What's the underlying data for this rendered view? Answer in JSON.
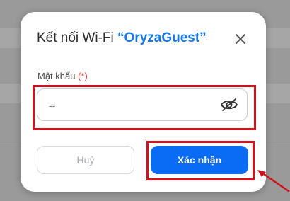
{
  "dialog": {
    "title_prefix": "Kết nối Wi-Fi ",
    "ssid": "“OryzaGuest”",
    "close_icon": "close-icon",
    "password": {
      "label": "Mật khẩu",
      "required_mark": "(*)",
      "placeholder": "--",
      "value": "",
      "toggle_icon": "eye-off-icon"
    },
    "buttons": {
      "cancel_label": "Huỷ",
      "confirm_label": "Xác nhận"
    }
  },
  "colors": {
    "accent": "#1677e8",
    "confirm_bg": "#0a6cf5",
    "annotation": "#d3111c",
    "required": "#e53935",
    "backdrop": "#9a9a9a"
  }
}
